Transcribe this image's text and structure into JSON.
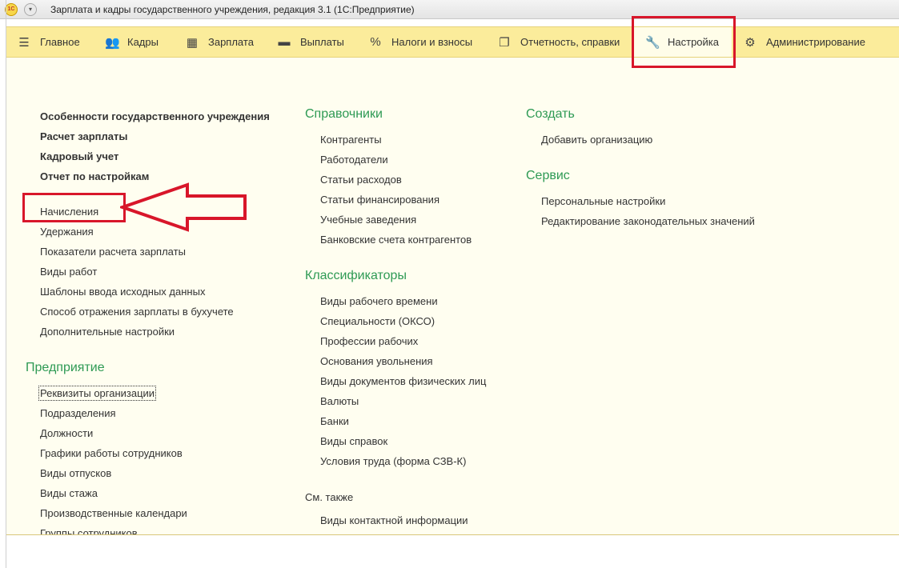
{
  "window": {
    "title": "Зарплата и кадры государственного учреждения, редакция 3.1  (1С:Предприятие)",
    "logo_text": "1С"
  },
  "sections": [
    {
      "label": "Главное",
      "icon": "menu-lines-icon"
    },
    {
      "label": "Кадры",
      "icon": "people-icon"
    },
    {
      "label": "Зарплата",
      "icon": "calculator-icon"
    },
    {
      "label": "Выплаты",
      "icon": "wallet-icon"
    },
    {
      "label": "Налоги и взносы",
      "icon": "percent-icon"
    },
    {
      "label": "Отчетность, справки",
      "icon": "documents-icon"
    },
    {
      "label": "Настройка",
      "icon": "wrench-icon"
    },
    {
      "label": "Администрирование",
      "icon": "gear-icon"
    }
  ],
  "active_section": "Настройка",
  "col1": {
    "bold_items": [
      "Особенности государственного учреждения",
      "Расчет зарплаты",
      "Кадровый учет",
      "Отчет по настройкам"
    ],
    "items": [
      "Начисления",
      "Удержания",
      "Показатели расчета зарплаты",
      "Виды работ",
      "Шаблоны ввода исходных данных",
      "Способ отражения зарплаты в бухучете",
      "Дополнительные настройки"
    ],
    "group_title": "Предприятие",
    "group_items": [
      "Реквизиты организации",
      "Подразделения",
      "Должности",
      "Графики работы сотрудников",
      "Виды отпусков",
      "Виды стажа",
      "Производственные календари",
      "Группы сотрудников"
    ]
  },
  "col2": {
    "spravochniki_title": "Справочники",
    "spravochniki_items": [
      "Контрагенты",
      "Работодатели",
      "Статьи расходов",
      "Статьи финансирования",
      "Учебные заведения",
      "Банковские счета контрагентов"
    ],
    "klassifikatory_title": "Классификаторы",
    "klassifikatory_items": [
      "Виды рабочего времени",
      "Специальности (ОКСО)",
      "Профессии рабочих",
      "Основания увольнения",
      "Виды документов физических лиц",
      "Валюты",
      "Банки",
      "Виды справок",
      "Условия труда (форма СЗВ-К)"
    ],
    "see_also_label": "См. также",
    "see_also_items": [
      "Виды контактной информации"
    ]
  },
  "col3": {
    "sozdat_title": "Создать",
    "sozdat_items": [
      "Добавить организацию"
    ],
    "servis_title": "Сервис",
    "servis_items": [
      "Персональные настройки",
      "Редактирование законодательных значений"
    ]
  },
  "colors": {
    "toolbar": "#fbec9b",
    "panel": "#fffef0",
    "group_title": "#2e9a54",
    "highlight": "#d8162a"
  }
}
